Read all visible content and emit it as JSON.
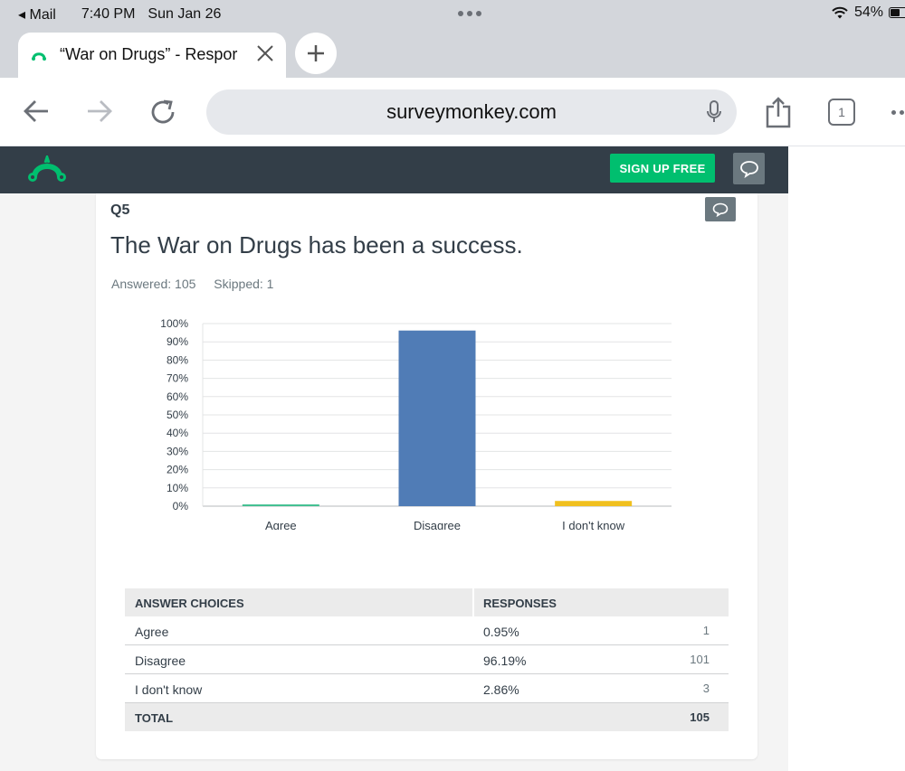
{
  "status_bar": {
    "back_app": "Mail",
    "time": "7:40 PM",
    "date": "Sun Jan 26",
    "battery": "54%"
  },
  "browser": {
    "tab_title": "“War on Drugs” - Respor",
    "url": "surveymonkey.com",
    "tab_count": "1"
  },
  "site_header": {
    "signup_label": "SIGN UP FREE",
    "brand_color": "#00bf6f",
    "header_color": "#333e48"
  },
  "question": {
    "number": "Q5",
    "title": "The War on Drugs has been a success.",
    "answered": "Answered: 105",
    "skipped": "Skipped: 1"
  },
  "chart_data": {
    "type": "bar",
    "categories": [
      "Agree",
      "Disagree",
      "I don't know"
    ],
    "values": [
      0.95,
      96.19,
      2.86
    ],
    "colors": [
      "#3fbf8f",
      "#507cb6",
      "#f0c01f"
    ],
    "ylim": [
      0,
      100
    ],
    "yticks": [
      "0%",
      "10%",
      "20%",
      "30%",
      "40%",
      "50%",
      "60%",
      "70%",
      "80%",
      "90%",
      "100%"
    ],
    "grid": true,
    "title": "",
    "xlabel": "",
    "ylabel": ""
  },
  "table": {
    "headers": {
      "choice": "ANSWER CHOICES",
      "responses": "RESPONSES"
    },
    "rows": [
      {
        "choice": "Agree",
        "pct": "0.95%",
        "count": "1"
      },
      {
        "choice": "Disagree",
        "pct": "96.19%",
        "count": "101"
      },
      {
        "choice": "I don't know",
        "pct": "2.86%",
        "count": "3"
      }
    ],
    "total_label": "TOTAL",
    "total_count": "105"
  }
}
